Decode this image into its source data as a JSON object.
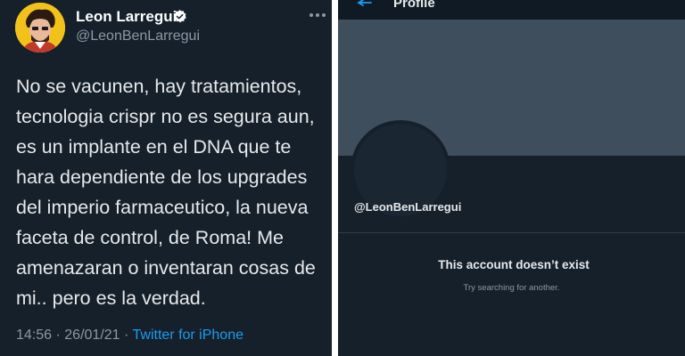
{
  "tweet": {
    "display_name": "Leon Larregui",
    "username": "@LeonBenLarregui",
    "avatar_icon": "cartoon-portrait-avatar",
    "verified_icon": "verified-badge-icon",
    "more_icon": "more-options-icon",
    "text_lines": [
      "No se vacunen, hay tratamientos,",
      "tecnologia crispr no es segura aun,",
      "es un implante en el DNA que te",
      "hara dependiente de los upgrades",
      "del imperio farmaceutico, la nueva",
      "faceta de control, de Roma! Me",
      "amenazaran o inventaran cosas de",
      "mi.. pero es la verdad."
    ],
    "time": "14:56",
    "separator": "·",
    "date": "26/01/21",
    "source": "Twitter for iPhone",
    "colors": {
      "background": "#15202b",
      "text": "#e7e9ea",
      "muted": "#8b98a5",
      "accent": "#1d9bf0",
      "avatar_bg": "#f2c21b"
    }
  },
  "profile": {
    "back_icon": "back-arrow-icon",
    "title": "Profile",
    "handle": "@LeonBenLarregui",
    "empty_title": "This account doesn’t exist",
    "empty_subtitle": "Try searching for another.",
    "colors": {
      "background": "#15202b",
      "banner": "#3f4e5d",
      "back_arrow": "#1d9bf0"
    }
  }
}
